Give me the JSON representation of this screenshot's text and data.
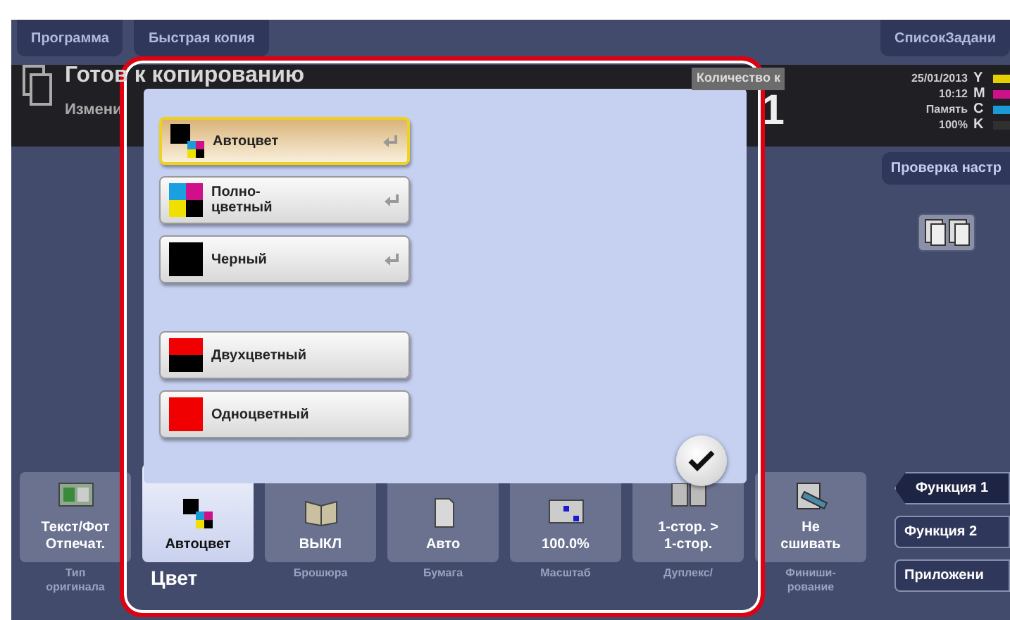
{
  "top_tabs": [
    {
      "label": "Программа"
    },
    {
      "label": "Быстрая копия"
    }
  ],
  "job_list_button": "СписокЗадани",
  "status": {
    "title": "Готов к копированию",
    "subtitle": "Измени",
    "copies_label": "Количество к",
    "copies": "1",
    "date": "25/01/2013",
    "time": "10:12",
    "memory_label": "Память",
    "memory": "100%",
    "toners": [
      {
        "label": "Y",
        "color": "#e6cf00"
      },
      {
        "label": "M",
        "color": "#d0108a"
      },
      {
        "label": "C",
        "color": "#1a9ad6"
      },
      {
        "label": "K",
        "color": "#303030"
      }
    ]
  },
  "check_settings_button": "Проверка настр",
  "color_groups": [
    [
      {
        "label": "Автоцвет",
        "kind": "auto",
        "selected": true,
        "return_icon": true
      },
      {
        "label": "Полно-\nцветный",
        "kind": "full",
        "selected": false,
        "return_icon": true
      },
      {
        "label": "Черный",
        "kind": "black",
        "selected": false,
        "return_icon": true
      }
    ],
    [
      {
        "label": "Двухцветный",
        "kind": "two_color",
        "selected": false,
        "return_icon": false
      },
      {
        "label": "Одноцветный",
        "kind": "single_color",
        "selected": false,
        "return_icon": false
      }
    ]
  ],
  "functions": [
    {
      "value": "Текст/Фот\nОтпечат.",
      "label": "Тип\nоригинала",
      "kind": "original",
      "selected": false
    },
    {
      "value": "Автоцвет",
      "label": "Цвет",
      "kind": "color",
      "selected": true
    },
    {
      "value": "ВЫКЛ",
      "label": "Брошюра",
      "kind": "booklet",
      "selected": false
    },
    {
      "value": "Авто",
      "label": "Бумага",
      "kind": "paper",
      "selected": false
    },
    {
      "value": "100.0%",
      "label": "Масштаб",
      "kind": "zoom",
      "selected": false
    },
    {
      "value": "1-стор. >\n1-стор.",
      "label": "Дуплекс/",
      "kind": "duplex",
      "selected": false
    },
    {
      "value": "Не\nсшивать",
      "label": "Финиши-\nрование",
      "kind": "finishing",
      "selected": false
    }
  ],
  "side_buttons": [
    {
      "label": "Функция 1",
      "selected": true
    },
    {
      "label": "Функция 2",
      "selected": false
    },
    {
      "label": "Приложени",
      "selected": false
    }
  ]
}
